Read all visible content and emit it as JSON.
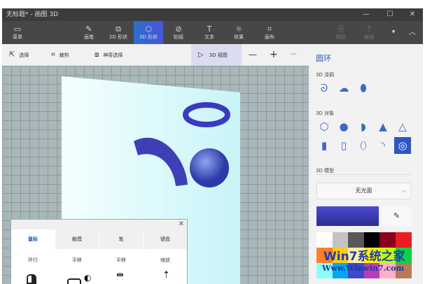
{
  "window": {
    "title": "无标题* - 画图 3D",
    "minimize": "—",
    "maximize": "☐",
    "close": "✕"
  },
  "ribbon": {
    "items": [
      {
        "label": "菜单",
        "icon": "▭"
      },
      {
        "label": "画笔",
        "icon": "✎"
      },
      {
        "label": "2D 形状",
        "icon": "⧉"
      },
      {
        "label": "3D 形状",
        "icon": "⬡"
      },
      {
        "label": "贴纸",
        "icon": "⊘"
      },
      {
        "label": "文本",
        "icon": "T"
      },
      {
        "label": "效果",
        "icon": "☼"
      },
      {
        "label": "画布",
        "icon": "⌗"
      },
      {
        "label": "粘贴",
        "icon": "⎘"
      },
      {
        "label": "撤消",
        "icon": "?"
      }
    ],
    "more": "▾",
    "collapse": "︿"
  },
  "toolbar": {
    "select": "选择",
    "crop": "裁剪",
    "magic_select": "神奇选择",
    "view3d": "3D 视图",
    "zoom_out": "—",
    "zoom_in": "+",
    "more": "···"
  },
  "panel": {
    "title": "圆环",
    "brush_section": "3D 涂鸦",
    "object_section": "3D 对象",
    "model_section": "3D 模型",
    "material": "无光面",
    "eyedropper": "✎",
    "colors": [
      "#ffffff",
      "#c3c3c3",
      "#585858",
      "#000000",
      "#88001b",
      "#ec1c24",
      "#ff7f27",
      "#ffca18",
      "#fdeca6",
      "#fff200",
      "#c4ff0e",
      "#0ed145",
      "#8cfffb",
      "#00a8f3",
      "#3f48cc",
      "#b83dba",
      "#ffaec8",
      "#b97a57"
    ],
    "current_color": "#3b3bbf"
  },
  "dialog": {
    "close": "✕",
    "tabs": [
      "鼠标",
      "触摸",
      "笔",
      "键盘"
    ],
    "labels": [
      "环行",
      "平移",
      "平移",
      "缩放"
    ]
  },
  "watermark": {
    "line1": "Win7系统之家",
    "line2": "Www.Winwin7.com"
  }
}
